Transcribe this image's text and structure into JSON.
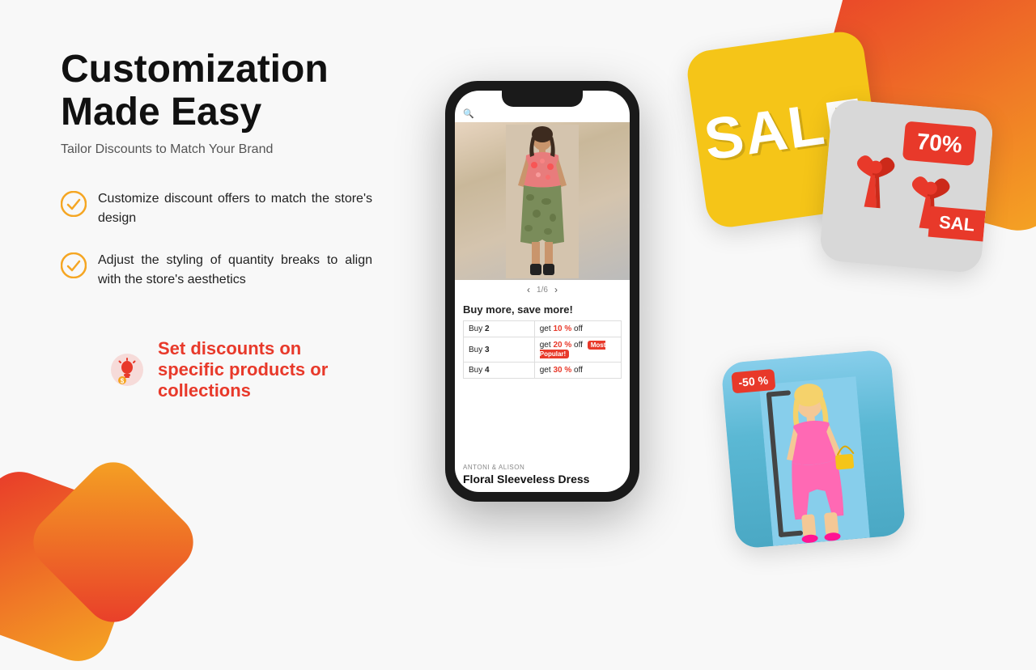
{
  "page": {
    "title": "Customization Made Easy",
    "subtitle": "Tailor Discounts to Match Your Brand"
  },
  "features": [
    {
      "id": "feature-1",
      "text": "Customize discount offers to match the store's design"
    },
    {
      "id": "feature-2",
      "text": "Adjust the styling of quantity breaks to align with the store's aesthetics"
    }
  ],
  "highlight": {
    "text": "Set discounts on specific products or collections"
  },
  "phone": {
    "image_counter": "1/6",
    "buy_more_title": "Buy more, save more!",
    "rows": [
      {
        "buy": "Buy",
        "qty": "2",
        "discount_prefix": "get",
        "pct": "10",
        "suffix": "% off",
        "badge": ""
      },
      {
        "buy": "Buy",
        "qty": "3",
        "discount_prefix": "get",
        "pct": "20",
        "suffix": "% off",
        "badge": "Most Popular!"
      },
      {
        "buy": "Buy",
        "qty": "4",
        "discount_prefix": "get",
        "pct": "30",
        "suffix": "% off",
        "badge": ""
      }
    ],
    "brand": "ANTONI & ALISON",
    "product_name": "Floral Sleeveless Dress"
  },
  "sale_cards": {
    "yellow_text": "SALE",
    "gray_pct": "70%",
    "gray_sale": "SAL",
    "red_pct": "-50 %"
  },
  "colors": {
    "accent": "#e8392a",
    "yellow": "#f5c518",
    "text_primary": "#111111",
    "text_secondary": "#555555"
  }
}
